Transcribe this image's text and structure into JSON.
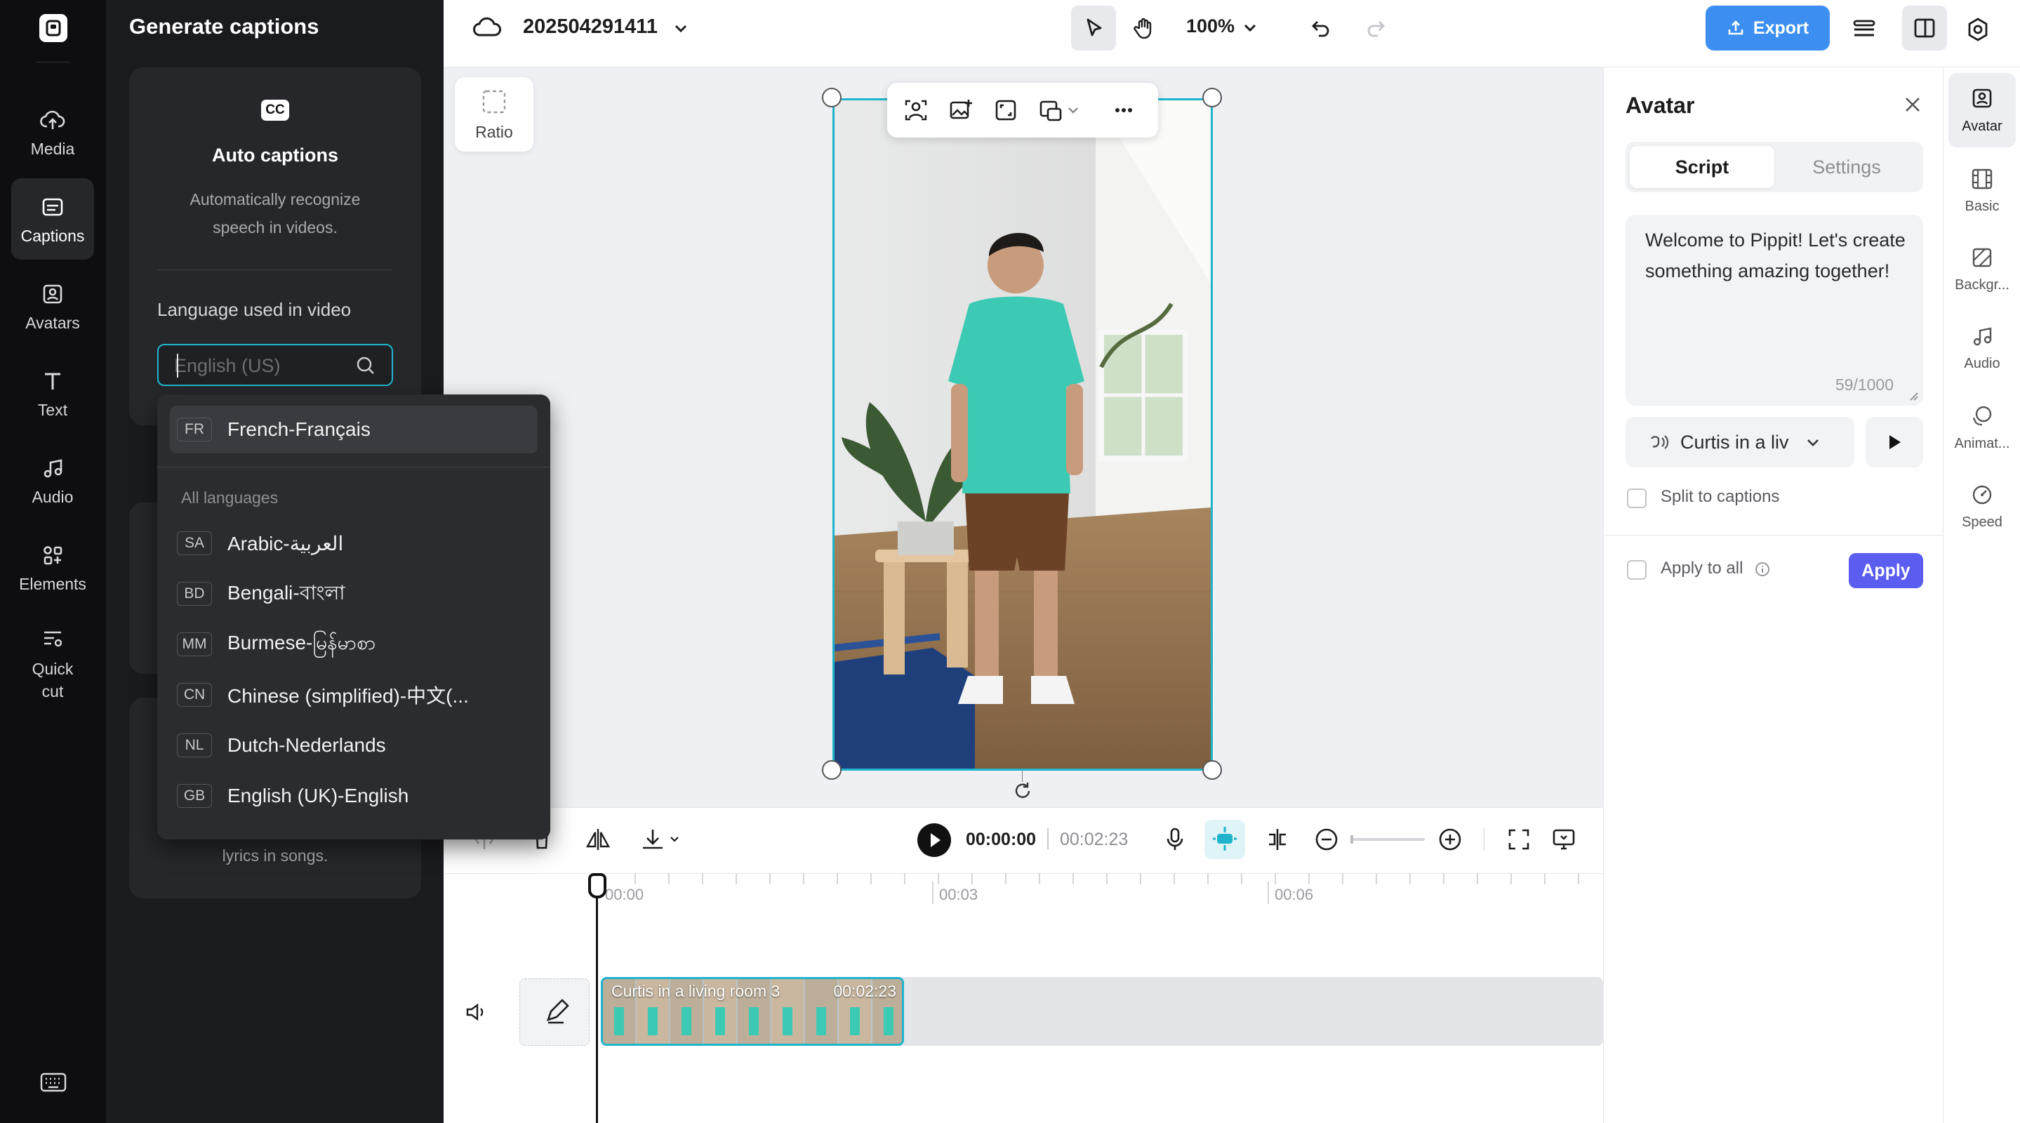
{
  "left_rail": {
    "items": [
      {
        "label": "Media",
        "icon": "cloud-upload-icon"
      },
      {
        "label": "Captions",
        "icon": "captions-icon"
      },
      {
        "label": "Avatars",
        "icon": "avatar-icon"
      },
      {
        "label": "Text",
        "icon": "text-t-icon"
      },
      {
        "label": "Audio",
        "icon": "music-note-icon"
      },
      {
        "label": "Elements",
        "icon": "elements-grid-icon"
      },
      {
        "label": "Quick cut",
        "icon": "scissors-icon"
      }
    ],
    "active": "Captions"
  },
  "captions_panel": {
    "title": "Generate captions",
    "auto": {
      "badge": "CC",
      "title": "Auto captions",
      "description": "Automatically recognize speech in videos.",
      "language_label": "Language used in video",
      "language_placeholder": "English (US)"
    },
    "lyrics_text": "lyrics in songs."
  },
  "language_dropdown": {
    "highlighted": {
      "code": "FR",
      "name": "French-Français"
    },
    "section_title": "All languages",
    "items": [
      {
        "code": "SA",
        "name": "Arabic-العربية"
      },
      {
        "code": "BD",
        "name": "Bengali-বাংলা"
      },
      {
        "code": "MM",
        "name": "Burmese-မြန်မာစာ"
      },
      {
        "code": "CN",
        "name": "Chinese (simplified)-中文(..."
      },
      {
        "code": "NL",
        "name": "Dutch-Nederlands"
      },
      {
        "code": "GB",
        "name": "English (UK)-English"
      }
    ]
  },
  "topbar": {
    "project_name": "202504291411",
    "zoom": "100%",
    "export_label": "Export"
  },
  "canvas": {
    "ratio_label": "Ratio"
  },
  "avatar_panel": {
    "title": "Avatar",
    "tabs": [
      "Script",
      "Settings"
    ],
    "active_tab": "Script",
    "script_text": "Welcome to Pippit! Let's create something amazing together!",
    "char_count": "59/1000",
    "voice": "Curtis in a liv",
    "split_label": "Split to captions",
    "apply_all_label": "Apply to all",
    "apply_button": "Apply"
  },
  "prop_rail": {
    "items": [
      {
        "label": "Avatar",
        "icon": "avatar-icon"
      },
      {
        "label": "Basic",
        "icon": "film-icon"
      },
      {
        "label": "Backgr...",
        "icon": "background-icon"
      },
      {
        "label": "Audio",
        "icon": "music-note-icon"
      },
      {
        "label": "Animat...",
        "icon": "animation-icon"
      },
      {
        "label": "Speed",
        "icon": "speed-icon"
      }
    ],
    "active": "Avatar"
  },
  "timeline": {
    "current_time": "00:00:00",
    "total_time": "00:02:23",
    "ticks": [
      "00:00",
      "00:03",
      "00:06"
    ],
    "clip_label": "Curtis  in a living room 3",
    "clip_duration": "00:02:23"
  },
  "colors": {
    "accent_cyan": "#1fb3cc",
    "export_blue": "#3c8ff0",
    "apply_purple": "#5b5cf0",
    "rail_dark": "#0e0e10"
  }
}
